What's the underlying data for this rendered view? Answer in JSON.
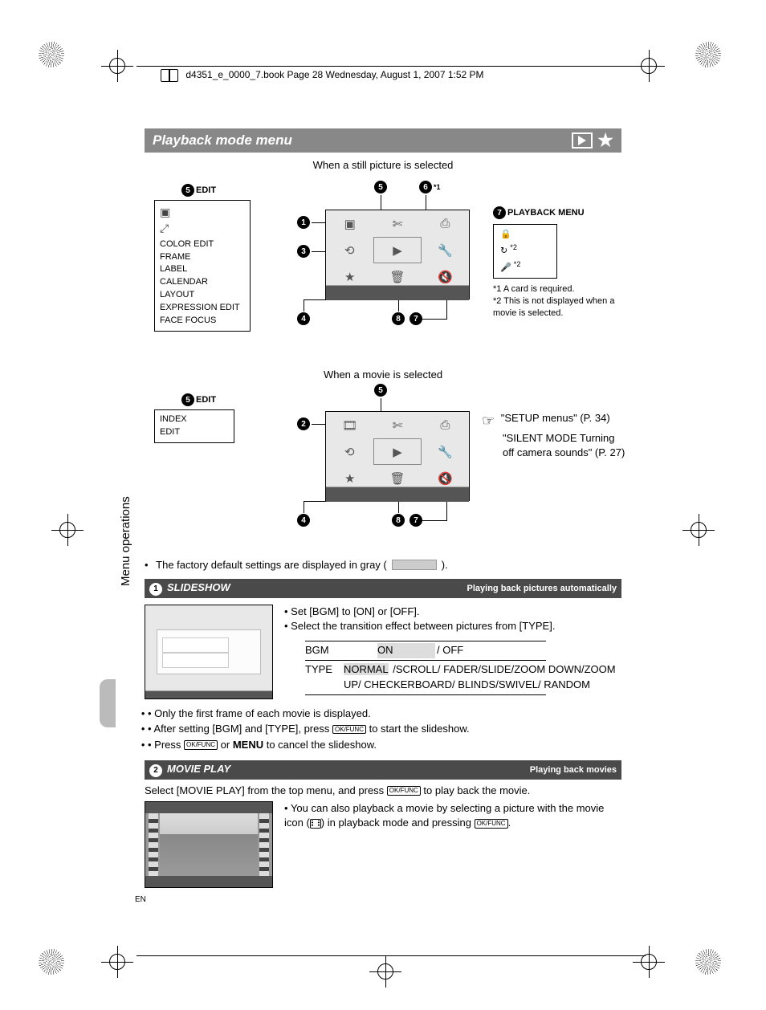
{
  "book_header": "d4351_e_0000_7.book  Page 28  Wednesday, August 1, 2007  1:52 PM",
  "section_title": "Playback mode menu",
  "still_label": "When a still picture is selected",
  "movie_label": "When a movie is selected",
  "side_label": "Menu operations",
  "edit_still": {
    "num": "5",
    "label": "EDIT",
    "items": [
      "COLOR EDIT",
      "FRAME",
      "LABEL",
      "CALENDAR",
      "LAYOUT",
      "EXPRESSION EDIT",
      "FACE FOCUS"
    ]
  },
  "edit_movie": {
    "num": "5",
    "label": "EDIT",
    "items": [
      "INDEX",
      "EDIT"
    ]
  },
  "playback_menu": {
    "num": "7",
    "label": "PLAYBACK MENU",
    "items": [
      "🔒",
      "↻ *2",
      "🎤 *2"
    ]
  },
  "callouts": {
    "1": "1",
    "2": "2",
    "3": "3",
    "4": "4",
    "5": "5",
    "6": "6",
    "7": "7",
    "8": "8"
  },
  "callout6_note": "*1",
  "footnote1": "*1 A card is required.",
  "footnote2": "*2 This is not displayed when a movie is selected.",
  "ref1": "\"SETUP menus\" (P. 34)",
  "ref2": "\"SILENT MODE Turning off camera sounds\" (P. 27)",
  "factory_note_pre": "The factory default settings are displayed in gray (",
  "factory_note_post": ").",
  "slideshow": {
    "num": "1",
    "title": "SLIDESHOW",
    "subtitle": "Playing back pictures automatically",
    "b1": "Set [BGM] to [ON] or [OFF].",
    "b2": "Select the transition effect between pictures from [TYPE].",
    "table": {
      "bgm_key": "BGM",
      "bgm_def": "ON",
      "bgm_rest": "/ OFF",
      "type_key": "TYPE",
      "type_def": "NORMAL",
      "type_rest": "/SCROLL/ FADER/SLIDE/ZOOM DOWN/ZOOM UP/ CHECKERBOARD/ BLINDS/SWIVEL/ RANDOM"
    },
    "n1": "Only the first frame of each movie is displayed.",
    "n2_a": "After setting [BGM] and [TYPE], press ",
    "n2_b": " to start the slideshow.",
    "n3_a": "Press ",
    "n3_b": " or ",
    "n3_menu": "MENU",
    "n3_c": " to cancel the slideshow."
  },
  "movieplay": {
    "num": "2",
    "title": "MOVIE PLAY",
    "subtitle": "Playing back movies",
    "intro_a": "Select [MOVIE PLAY] from the top menu, and press ",
    "intro_b": " to play back the movie.",
    "b1_a": "You can also playback a movie by selecting a picture with the movie icon (",
    "b1_b": ") in playback mode and pressing ",
    "b1_c": "."
  },
  "okfunc_label": "OK/FUNC",
  "page_lang": "EN"
}
